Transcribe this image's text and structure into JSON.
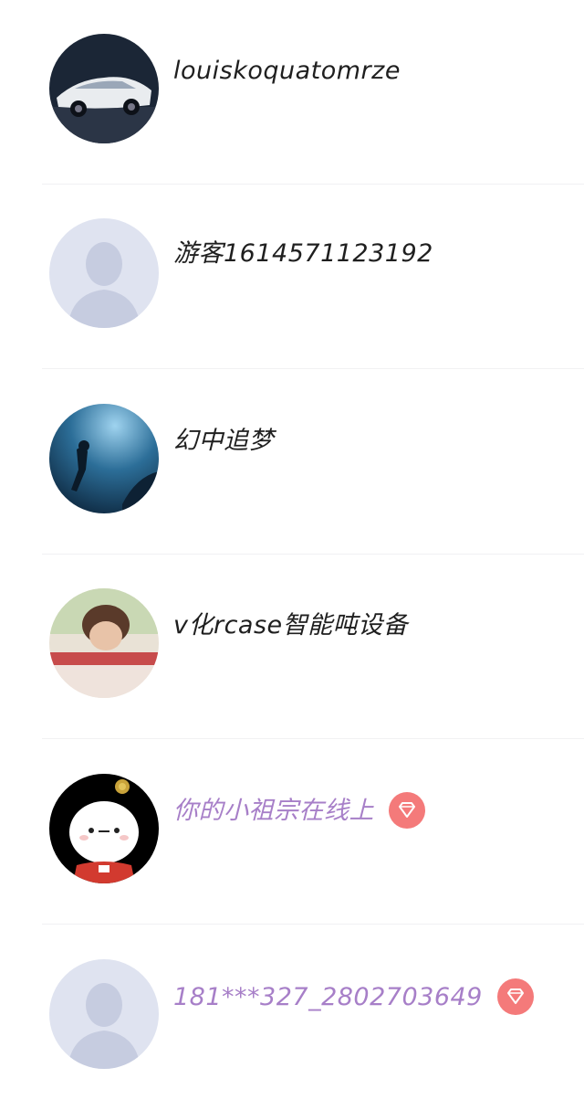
{
  "users": [
    {
      "name": "louiskoquatomrze",
      "vip": false
    },
    {
      "name": "游客1614571123192",
      "vip": false
    },
    {
      "name": "幻中追梦",
      "vip": false
    },
    {
      "name": "v化rcase智能吨设备",
      "vip": false
    },
    {
      "name": "你的小祖宗在线上",
      "vip": true
    },
    {
      "name": "181***327_2802703649",
      "vip": true
    }
  ],
  "colors": {
    "name_text": "#1f1f1f",
    "vip_name_text": "#a77fc8",
    "vip_badge": "#f47a7a",
    "default_avatar_bg": "#dfe3f0",
    "default_avatar_figure": "#c6cce0"
  },
  "icons": {
    "vip_badge": "diamond-icon",
    "default_avatar": "default-person-avatar"
  }
}
